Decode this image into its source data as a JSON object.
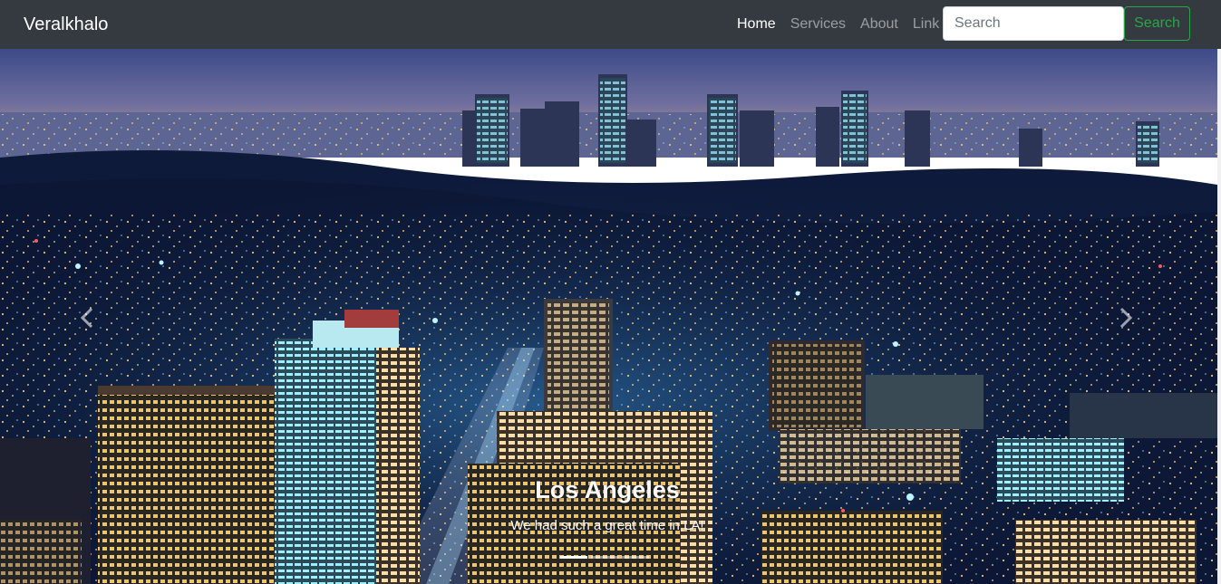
{
  "navbar": {
    "brand": "Veralkhalo",
    "links": [
      {
        "label": "Home",
        "active": true
      },
      {
        "label": "Services",
        "active": false
      },
      {
        "label": "About",
        "active": false
      },
      {
        "label": "Link",
        "active": false
      }
    ],
    "search": {
      "placeholder": "Search",
      "value": "",
      "button_label": "Search"
    }
  },
  "carousel": {
    "slides": [
      {
        "title": "Los Angeles",
        "caption": "We had such a great time in LA!"
      }
    ],
    "indicator_count": 3,
    "active_index": 0,
    "prev_icon": "chevron-left-icon",
    "next_icon": "chevron-right-icon"
  },
  "colors": {
    "navbar_bg": "#343a40",
    "search_button": "#28a745",
    "sky_top": "#3a4a8a",
    "city_lights": "#ffd27a"
  }
}
